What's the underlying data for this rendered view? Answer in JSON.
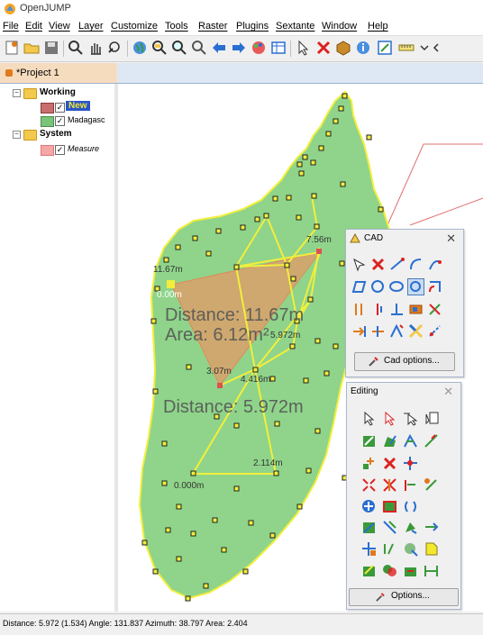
{
  "window": {
    "title": "OpenJUMP"
  },
  "menu": [
    "File",
    "Edit",
    "View",
    "Layer",
    "Customize",
    "Tools",
    "Raster",
    "Plugins",
    "Sextante",
    "Window",
    "Help"
  ],
  "tab": {
    "label": "*Project 1"
  },
  "tree": {
    "working": "Working",
    "layer_new": "New",
    "layer_madagascar": "Madagasc",
    "system": "System",
    "layer_measure": "Measure"
  },
  "map": {
    "labels": {
      "d1": "11.67m",
      "d2": "0.00m",
      "d3": "7.56m",
      "d4": "5.972m",
      "d5": "3.07m",
      "d6": "4.416m",
      "d7": "2.114m",
      "d8": "0.000m"
    },
    "distance_big": "Distance: 11.67m",
    "area_big": "Area: 6.12m²",
    "distance_big2": "Distance: 5.972m"
  },
  "cad": {
    "title": "CAD",
    "options_label": "Cad options..."
  },
  "editing": {
    "title": "Editing",
    "options_label": "Options..."
  },
  "status": {
    "text": "Distance: 5.972 (1.534)  Angle: 131.837  Azimuth: 38.797  Area: 2.404"
  },
  "colors": {
    "polygon_fill": "#8fd48a",
    "polygon_stroke": "#f2ee3c",
    "measure_fill": "#d9a06a",
    "tab_bg": "#f6dcbf"
  }
}
